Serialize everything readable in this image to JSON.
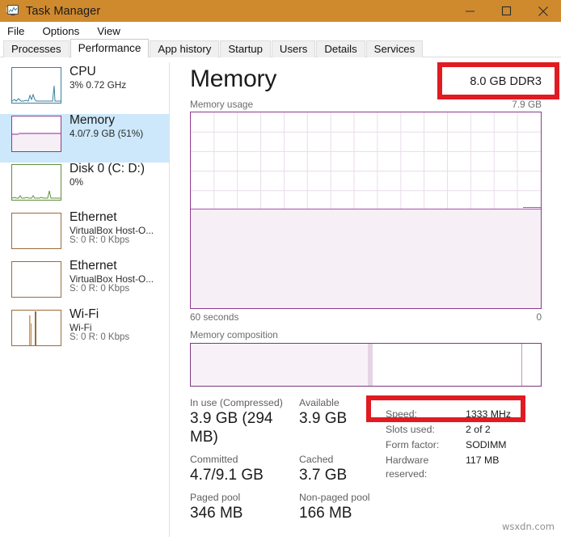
{
  "window": {
    "title": "Task Manager",
    "icon": "task-manager-icon",
    "controls": {
      "minimize": "minimize-icon",
      "maximize": "maximize-icon",
      "close": "close-icon"
    }
  },
  "menu": {
    "items": [
      {
        "label": "File"
      },
      {
        "label": "Options"
      },
      {
        "label": "View"
      }
    ]
  },
  "tabs": {
    "active": "Performance",
    "items": [
      {
        "label": "Processes"
      },
      {
        "label": "Performance"
      },
      {
        "label": "App history"
      },
      {
        "label": "Startup"
      },
      {
        "label": "Users"
      },
      {
        "label": "Details"
      },
      {
        "label": "Services"
      }
    ]
  },
  "sidebar": {
    "items": [
      {
        "name": "CPU",
        "sub": "3%  0.72 GHz",
        "sub2": "",
        "selected": false,
        "color": "#3a7f9c"
      },
      {
        "name": "Memory",
        "sub": "4.0/7.9 GB (51%)",
        "sub2": "",
        "selected": true,
        "color": "#8e3a8e"
      },
      {
        "name": "Disk 0 (C: D:)",
        "sub": "0%",
        "sub2": "",
        "selected": false,
        "color": "#5f8f3a"
      },
      {
        "name": "Ethernet",
        "sub": "VirtualBox Host-O...",
        "sub2": "S: 0 R: 0 Kbps",
        "selected": false,
        "color": "#9c6b3a"
      },
      {
        "name": "Ethernet",
        "sub": "VirtualBox Host-O...",
        "sub2": "S: 0 R: 0 Kbps",
        "selected": false,
        "color": "#9c6b3a"
      },
      {
        "name": "Wi-Fi",
        "sub": "Wi-Fi",
        "sub2": "S: 0 R: 0 Kbps",
        "selected": false,
        "color": "#9c6b3a"
      }
    ]
  },
  "main": {
    "title": "Memory",
    "spec_summary": "8.0 GB DDR3",
    "usage_graph": {
      "caption": "Memory usage",
      "max_label": "7.9 GB",
      "x_left_label": "60 seconds",
      "x_right_label": "0",
      "fill_percent": 51
    },
    "composition": {
      "caption": "Memory composition",
      "segments": [
        {
          "name": "in-use",
          "percent": 50.5
        },
        {
          "name": "modified",
          "percent": 1.5
        },
        {
          "name": "standby",
          "percent": 42.8
        },
        {
          "name": "free",
          "percent": 5.2
        }
      ]
    },
    "stats": [
      {
        "label": "In use (Compressed)",
        "value": "3.9 GB (294 MB)"
      },
      {
        "label": "Available",
        "value": "3.9 GB"
      },
      {
        "label": "Committed",
        "value": "4.7/9.1 GB"
      },
      {
        "label": "Cached",
        "value": "3.7 GB"
      },
      {
        "label": "Paged pool",
        "value": "346 MB"
      },
      {
        "label": "Non-paged pool",
        "value": "166 MB"
      }
    ],
    "specs": [
      {
        "key": "Speed:",
        "value": "1333 MHz"
      },
      {
        "key": "Slots used:",
        "value": "2 of 2"
      },
      {
        "key": "Form factor:",
        "value": "SODIMM"
      },
      {
        "key": "Hardware reserved:",
        "value": "117 MB"
      }
    ]
  },
  "annotations": {
    "highlight_color": "#e01b22",
    "boxes": [
      {
        "name": "memory-spec-highlight",
        "target": "8.0 GB DDR3"
      },
      {
        "name": "speed-highlight",
        "target": "1333 MHz"
      }
    ]
  },
  "watermark": "wsxdn.com"
}
